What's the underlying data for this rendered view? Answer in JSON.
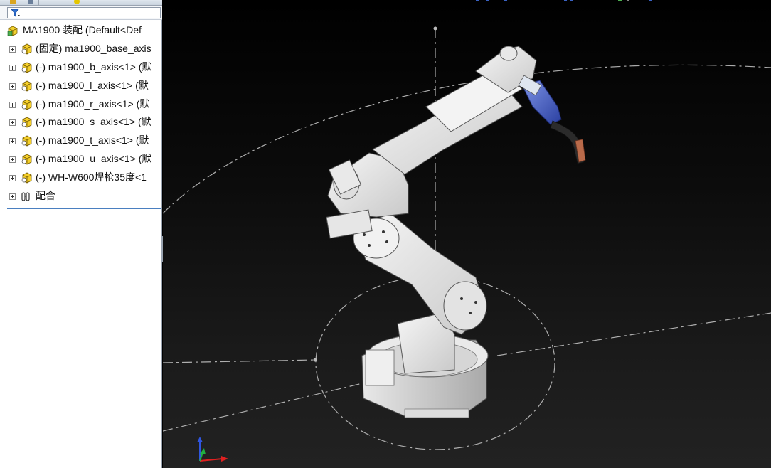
{
  "feature_tree": {
    "root": {
      "label": "MA1900 装配 (Default<Def",
      "icon": "assembly-icon"
    },
    "items": [
      {
        "label": "(固定) ma1900_base_axis",
        "icon": "part-icon"
      },
      {
        "label": "(-) ma1900_b_axis<1> (默",
        "icon": "part-icon"
      },
      {
        "label": "(-) ma1900_l_axis<1> (默",
        "icon": "part-icon"
      },
      {
        "label": "(-) ma1900_r_axis<1> (默",
        "icon": "part-icon"
      },
      {
        "label": "(-) ma1900_s_axis<1> (默",
        "icon": "part-icon"
      },
      {
        "label": "(-) ma1900_t_axis<1> (默",
        "icon": "part-icon"
      },
      {
        "label": "(-) ma1900_u_axis<1> (默",
        "icon": "part-icon"
      },
      {
        "label": "(-) WH-W600焊枪35度<1",
        "icon": "part-icon"
      },
      {
        "label": "配合",
        "icon": "mates-icon"
      }
    ]
  },
  "panel_tabs": [
    "feature-manager-tab",
    "property-manager-tab",
    "display-manager-tab"
  ],
  "colors": {
    "viewport_top": "#000000",
    "viewport_bottom": "#222222",
    "robot_body": "#e9e9e9",
    "torch_blue": "#3d58c8",
    "torch_tip": "#b96a4a",
    "selection_accent": "#4a7fc0"
  }
}
